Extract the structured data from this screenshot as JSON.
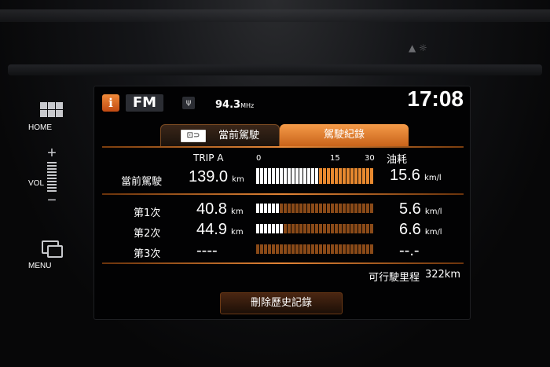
{
  "side_buttons": {
    "home_label": "HOME",
    "vol_plus": "+",
    "vol_label": "VOL",
    "vol_minus": "−",
    "menu_label": "MENU"
  },
  "status_bar": {
    "info_icon": "i",
    "band": "FM",
    "antenna_icon": "antenna-icon",
    "frequency": "94.3",
    "frequency_unit": "MHz",
    "clock": "17:08"
  },
  "tabs": [
    {
      "label": "當前駕駛",
      "active": false,
      "icon": "car-icon"
    },
    {
      "label": "駕駛紀錄",
      "active": true
    }
  ],
  "header": {
    "trip_label": "TRIP A",
    "scale_0": "0",
    "scale_15": "15",
    "scale_30": "30",
    "fuel_label": "油耗"
  },
  "rows": [
    {
      "label": "當前駕駛",
      "distance": "139.0",
      "dist_unit": "km",
      "economy": "15.6",
      "econ_unit": "km/l",
      "economy_kml": 15.6,
      "row_type": "current"
    },
    {
      "label": "第1次",
      "distance": "40.8",
      "dist_unit": "km",
      "economy": "5.6",
      "econ_unit": "km/l",
      "economy_kml": 5.6,
      "row_type": "history"
    },
    {
      "label": "第2次",
      "distance": "44.9",
      "dist_unit": "km",
      "economy": "6.6",
      "econ_unit": "km/l",
      "economy_kml": 6.6,
      "row_type": "history"
    },
    {
      "label": "第3次",
      "distance": "----",
      "dist_unit": "",
      "economy": "--.-",
      "econ_unit": "",
      "economy_kml": 0,
      "row_type": "history"
    }
  ],
  "scale_max_kml": 30,
  "range": {
    "label": "可行駛里程",
    "value": "322km"
  },
  "delete_button": "刪除歷史記錄",
  "colors": {
    "accent_orange": "#e8892f",
    "bar_white": "#ffffff",
    "bar_orange": "#e8892f",
    "bar_unfilled": "#8a4a18"
  }
}
